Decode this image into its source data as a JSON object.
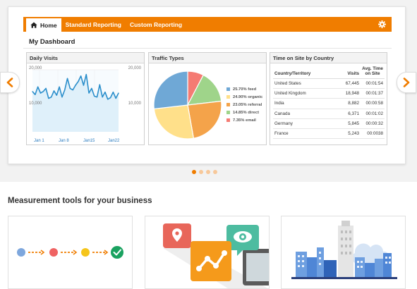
{
  "nav": {
    "tabs": [
      {
        "label": "Home",
        "icon": "home-icon",
        "active": true
      },
      {
        "label": "Standard Reporting"
      },
      {
        "label": "Custom Reporting"
      }
    ],
    "settings_icon": "gear-icon",
    "accent": "#f07d00"
  },
  "dashboard": {
    "title": "My Dashboard"
  },
  "panels": {
    "daily_visits": {
      "title": "Daily Visits"
    },
    "traffic_types": {
      "title": "Traffic Types"
    },
    "time_on_site": {
      "title": "Time on Site by Country"
    }
  },
  "chart_data": [
    {
      "type": "area",
      "title": "Daily Visits",
      "ylim": [
        0,
        20000
      ],
      "y_left_ticks": [
        "20,000",
        "10,000"
      ],
      "y_right_ticks": [
        "20,000",
        "10,000"
      ],
      "x_tick_labels": [
        "Jan 1",
        "Jan 8",
        "Jan15",
        "Jan22"
      ],
      "series": [
        {
          "values": [
            13000,
            12000,
            14500,
            12500,
            13000,
            14000,
            10800,
            11200,
            13200,
            11800,
            14500,
            11200,
            13500,
            17200,
            14000,
            13500,
            15000,
            16200,
            18000,
            15000,
            18500,
            12500,
            14000,
            11500,
            11200,
            15200,
            11200,
            12800,
            10500,
            11000,
            12800,
            10800,
            12500
          ]
        }
      ],
      "grid": true
    },
    {
      "type": "pie",
      "title": "Traffic Types",
      "slices": [
        {
          "label": "feed",
          "value": 25.7,
          "text": "25.70% feed",
          "color": "#6fa8d6"
        },
        {
          "label": "organic",
          "value": 24.9,
          "text": "24.90% organic",
          "color": "#ffe08a"
        },
        {
          "label": "referral",
          "value": 23.05,
          "text": "23.05% referral",
          "color": "#f4a34a"
        },
        {
          "label": "direct",
          "value": 14.85,
          "text": "14.85% direct",
          "color": "#9fd48a"
        },
        {
          "label": "email",
          "value": 7.35,
          "text": "7.35% email",
          "color": "#f57b73"
        }
      ]
    },
    {
      "type": "table",
      "title": "Time on Site by Country",
      "columns": [
        "Country/Territory",
        "Visits",
        "Avg. Time on Site"
      ],
      "rows": [
        [
          "United States",
          "67,445",
          "00:01:54"
        ],
        [
          "United Kingdom",
          "18,948",
          "00:01:37"
        ],
        [
          "India",
          "8,882",
          "00:00:58"
        ],
        [
          "Canada",
          "6,371",
          "00:01:02"
        ],
        [
          "Germany",
          "5,845",
          "00:00:32"
        ],
        [
          "France",
          "5,243",
          "00:0038"
        ]
      ]
    }
  ],
  "slider": {
    "prev_icon": "chevron-left-icon",
    "next_icon": "chevron-right-icon",
    "dots": 4,
    "active_dot": 1
  },
  "section": {
    "title": "Measurement tools for your business"
  },
  "cards": [
    {
      "icon": "measurement-flow-illustration"
    },
    {
      "icon": "location-analytics-illustration"
    },
    {
      "icon": "city-cloud-illustration"
    }
  ],
  "colors": {
    "orange": "#f07d00",
    "blue_line": "#2a8ecb",
    "area_fill": "#dff0fa",
    "slider_bg": "#f2f2f2"
  }
}
